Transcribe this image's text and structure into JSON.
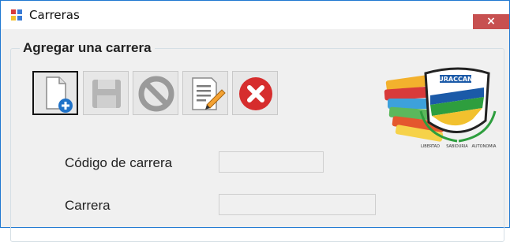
{
  "window": {
    "title": "Carreras",
    "close_glyph": "×"
  },
  "group": {
    "title": "Agregar una carrera"
  },
  "toolbar": {
    "buttons": [
      {
        "name": "new-icon",
        "state": "selected"
      },
      {
        "name": "save-icon",
        "state": "disabled"
      },
      {
        "name": "cancel-icon",
        "state": "disabled"
      },
      {
        "name": "edit-icon",
        "state": "enabled"
      },
      {
        "name": "delete-icon",
        "state": "enabled"
      }
    ]
  },
  "form": {
    "codigo_label": "Código de carrera",
    "codigo_value": "",
    "carrera_label": "Carrera",
    "carrera_value": ""
  },
  "logo": {
    "text": "URACCAN",
    "bottom_words": [
      "LIBERTAD",
      "SABIDURIA",
      "AUTONOMIA"
    ]
  },
  "colors": {
    "close_button": "#c75050",
    "window_border": "#1f78d1",
    "background": "#f0f0f0"
  }
}
